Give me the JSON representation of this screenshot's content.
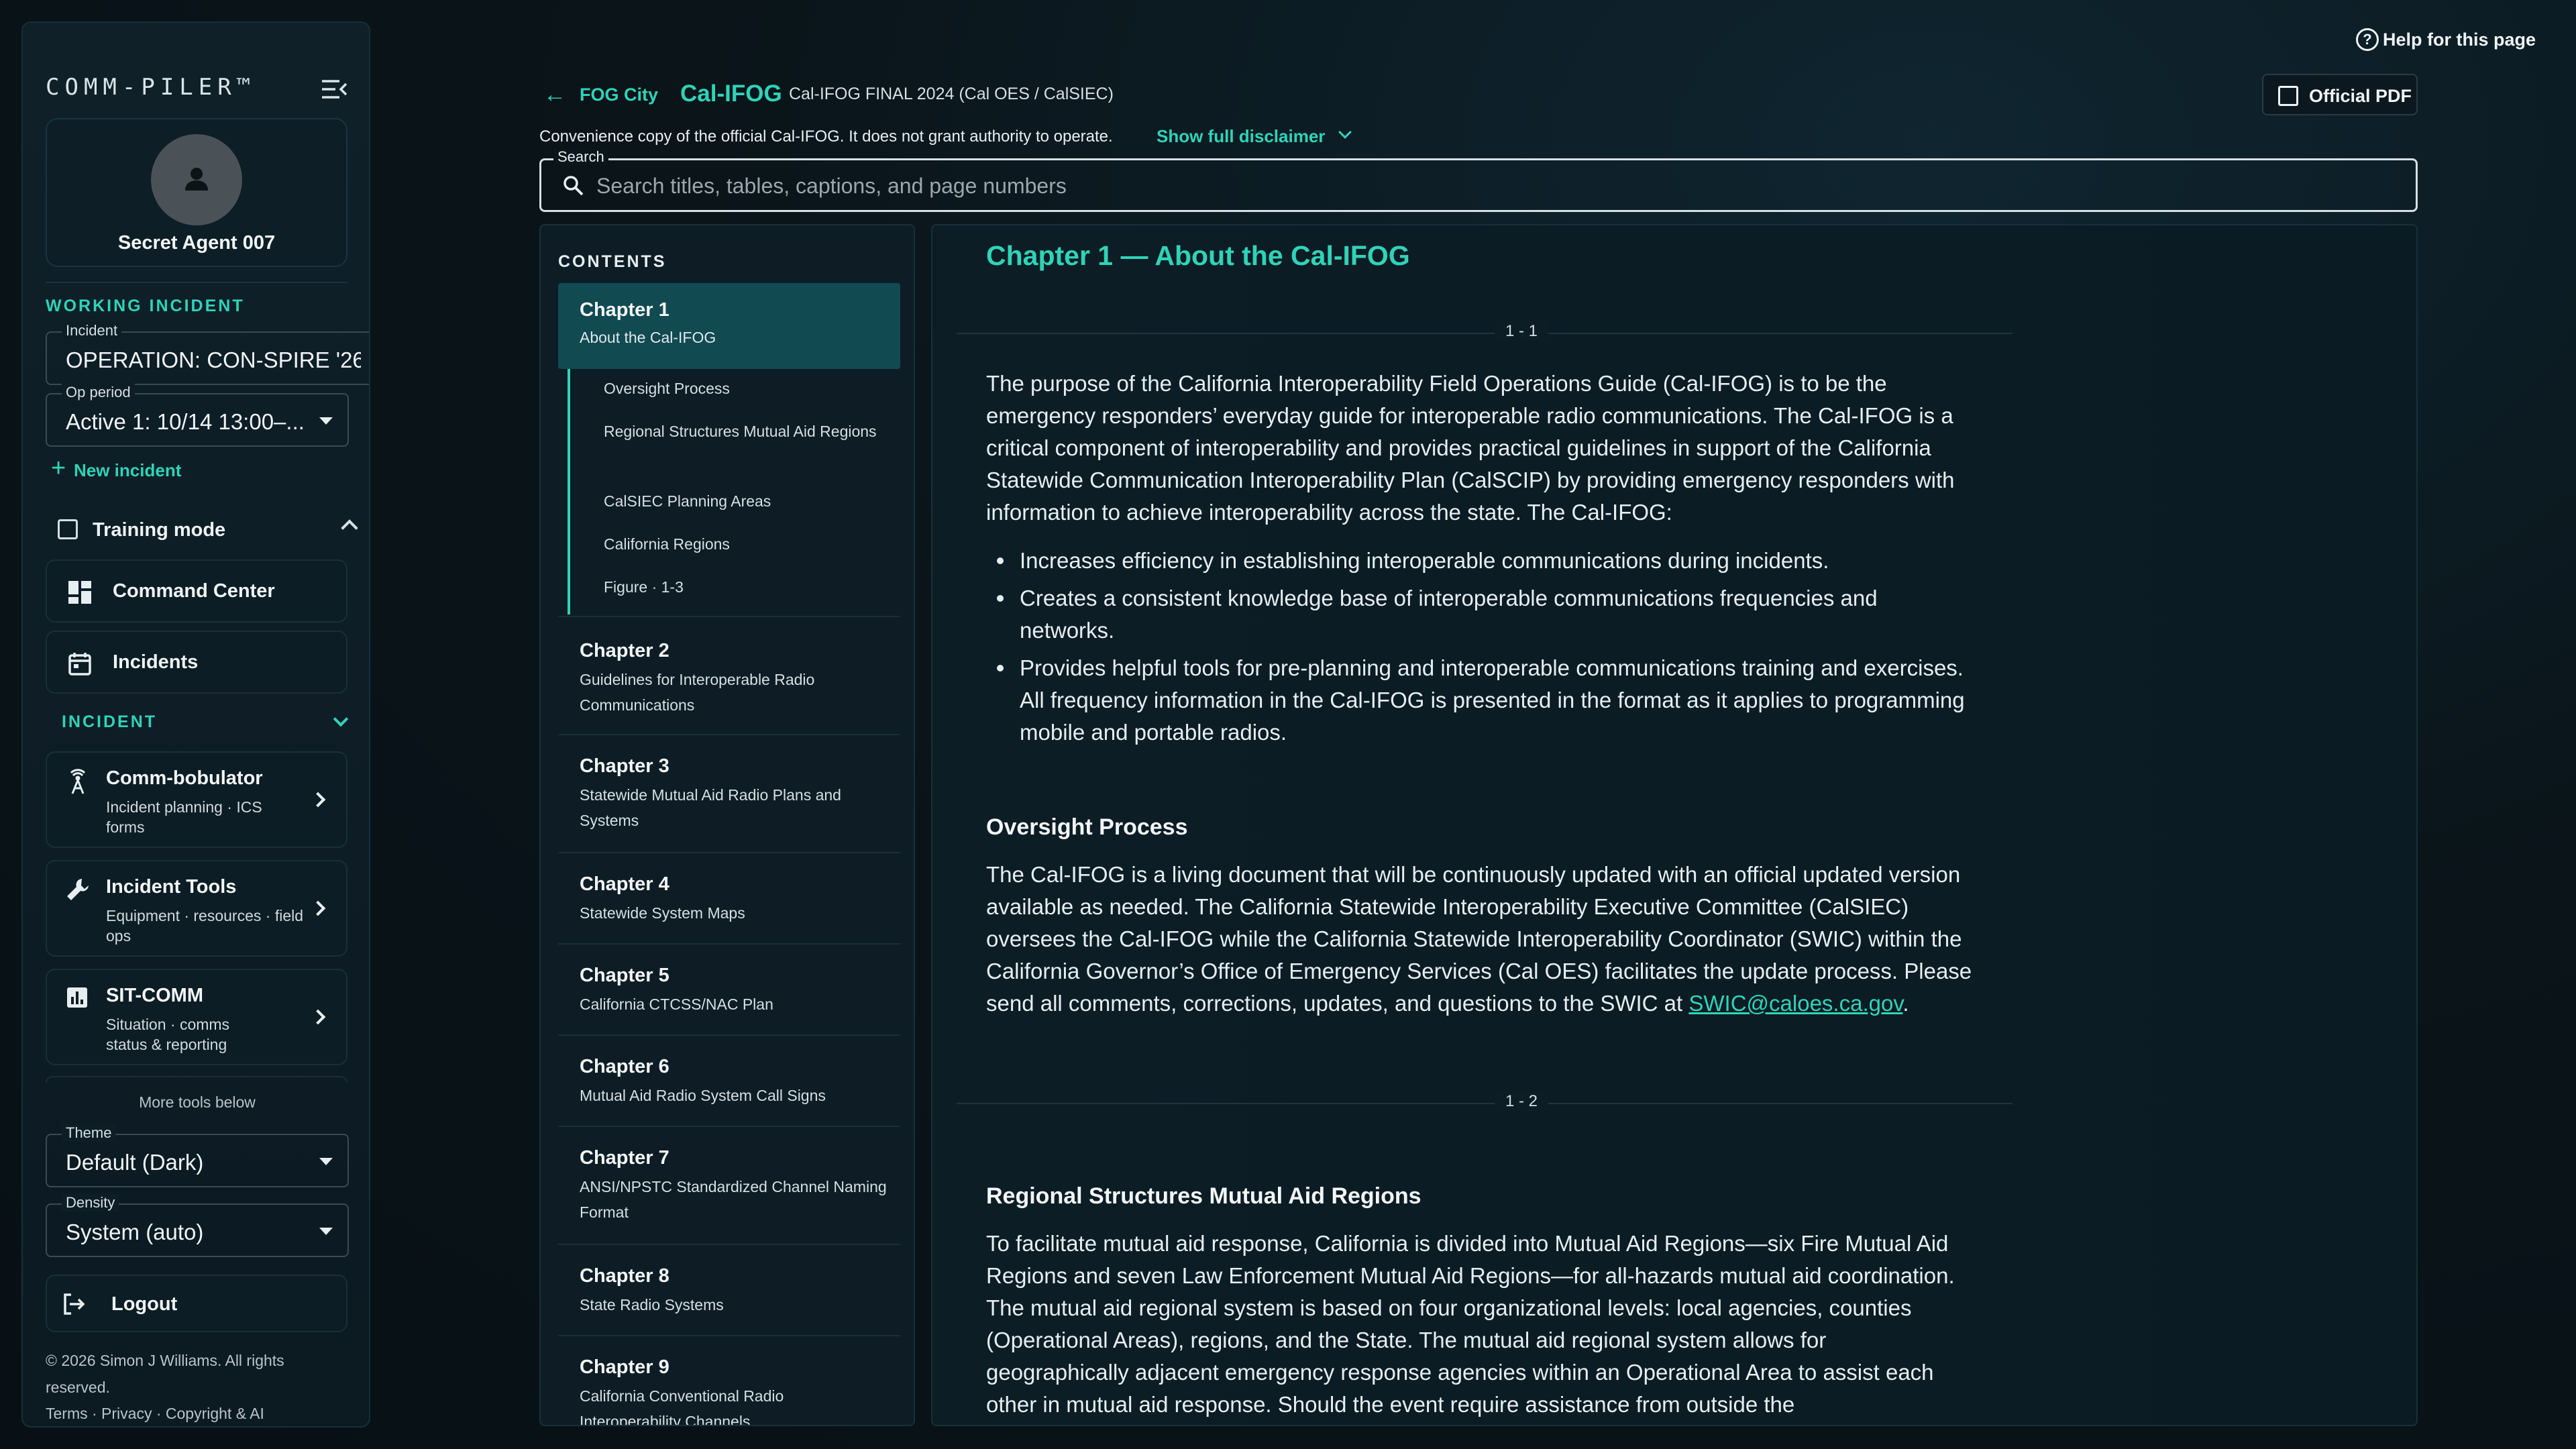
{
  "sidebar": {
    "logo": "COMM-PILER™",
    "profile_name": "Secret Agent 007",
    "working_incident_label": "WORKING INCIDENT",
    "incident": {
      "label": "Incident",
      "value": "OPERATION: CON-SPIRE '26"
    },
    "op_period": {
      "label": "Op period",
      "value": "Active 1: 10/14 13:00–..."
    },
    "new_incident": "New incident",
    "training_mode": "Training mode",
    "nav": [
      {
        "label": "Command Center",
        "icon": "dashboard-icon"
      },
      {
        "label": "Incidents",
        "icon": "calendar-icon"
      }
    ],
    "incident_section": "INCIDENT",
    "tools": [
      {
        "title": "Comm-bobulator",
        "subtitle": "Incident planning · ICS forms",
        "icon": "antenna-icon"
      },
      {
        "title": "Incident Tools",
        "subtitle": "Equipment · resources · field ops",
        "icon": "wrench-icon"
      },
      {
        "title": "SIT-COMM",
        "subtitle": "Situation · comms status & reporting",
        "icon": "bar-chart-icon"
      }
    ],
    "more_tools": "More tools below",
    "theme": {
      "label": "Theme",
      "value": "Default (Dark)"
    },
    "density": {
      "label": "Density",
      "value": "System (auto)"
    },
    "logout": "Logout",
    "copyright": "© 2026 Simon J Williams. All rights reserved.",
    "footer_links": "Terms · Privacy · Copyright & AI"
  },
  "header": {
    "help": "Help for this page",
    "crumb_parent": "FOG City",
    "title": "Cal-IFOG",
    "subtitle": "Cal-IFOG FINAL 2024 (Cal OES / CalSIEC)",
    "pdf_button": "Official PDF",
    "disclaimer": "Convenience copy of the official Cal-IFOG. It does not grant authority to operate.",
    "disclaimer_link": "Show full disclaimer",
    "search_label": "Search",
    "search_placeholder": "Search titles, tables, captions, and page numbers"
  },
  "contents": {
    "header": "CONTENTS",
    "chapters": [
      {
        "title": "Chapter 1",
        "subtitle": "About the Cal-IFOG",
        "active": true
      },
      {
        "title": "Chapter 2",
        "subtitle": "Guidelines for Interoperable Radio Communications"
      },
      {
        "title": "Chapter 3",
        "subtitle": "Statewide Mutual Aid Radio Plans and Systems"
      },
      {
        "title": "Chapter 4",
        "subtitle": "Statewide System Maps"
      },
      {
        "title": "Chapter 5",
        "subtitle": "California CTCSS/NAC Plan"
      },
      {
        "title": "Chapter 6",
        "subtitle": "Mutual Aid Radio System Call Signs"
      },
      {
        "title": "Chapter 7",
        "subtitle": "ANSI/NPSTC Standardized Channel Naming Format"
      },
      {
        "title": "Chapter 8",
        "subtitle": "State Radio Systems"
      },
      {
        "title": "Chapter 9",
        "subtitle": "California Conventional Radio Interoperability Channels"
      }
    ],
    "sections": [
      "Oversight Process",
      "Regional Structures Mutual Aid Regions",
      "CalSIEC Planning Areas",
      "California Regions",
      "Figure · 1-3"
    ]
  },
  "doc": {
    "title": "Chapter 1 — About the Cal-IFOG",
    "page_1": "1 - 1",
    "intro": "The purpose of the California Interoperability Field Operations Guide (Cal-IFOG) is to be the emergency responders’ everyday guide for interoperable radio communications. The Cal-IFOG is a critical component of interoperability and provides practical guidelines in support of the California Statewide Communication Interoperability Plan (CalSCIP) by providing emergency responders with information to achieve interoperability across the state. The Cal-IFOG:",
    "bullets": [
      "Increases efficiency in establishing interoperable communications during incidents.",
      "Creates a consistent knowledge base of interoperable communications frequencies and networks.",
      "Provides helpful tools for pre-planning and interoperable communications training and exercises. All frequency information in the Cal-IFOG is presented in the format as it applies to programming mobile and portable radios."
    ],
    "h_oversight": "Oversight Process",
    "oversight": "The Cal-IFOG is a living document that will be continuously updated with an official updated version available as needed. The California Statewide Interoperability Executive Committee (CalSIEC) oversees the Cal-IFOG while the California Statewide Interoperability Coordinator (SWIC) within the California Governor’s Office of Emergency Services (Cal OES) facilitates the update process. Please send all comments, corrections, updates, and questions to the SWIC at",
    "email": "SWIC@caloes.ca.gov",
    "period": ".",
    "page_2": "1 - 2",
    "h_regional": "Regional Structures Mutual Aid Regions",
    "regional": "To facilitate mutual aid response, California is divided into Mutual Aid Regions—six Fire Mutual Aid Regions and seven Law Enforcement Mutual Aid Regions—for all-hazards mutual aid coordination. The mutual aid regional system is based on four organizational levels: local agencies, counties (Operational Areas), regions, and the State. The mutual aid regional system allows for geographically adjacent emergency response agencies within an Operational Area to assist each other in mutual aid response. Should the event require assistance from outside the"
  },
  "colors": {
    "accent": "#2fd3b8",
    "active_chapter_bg": "#124a52",
    "background": "#0a141a"
  }
}
